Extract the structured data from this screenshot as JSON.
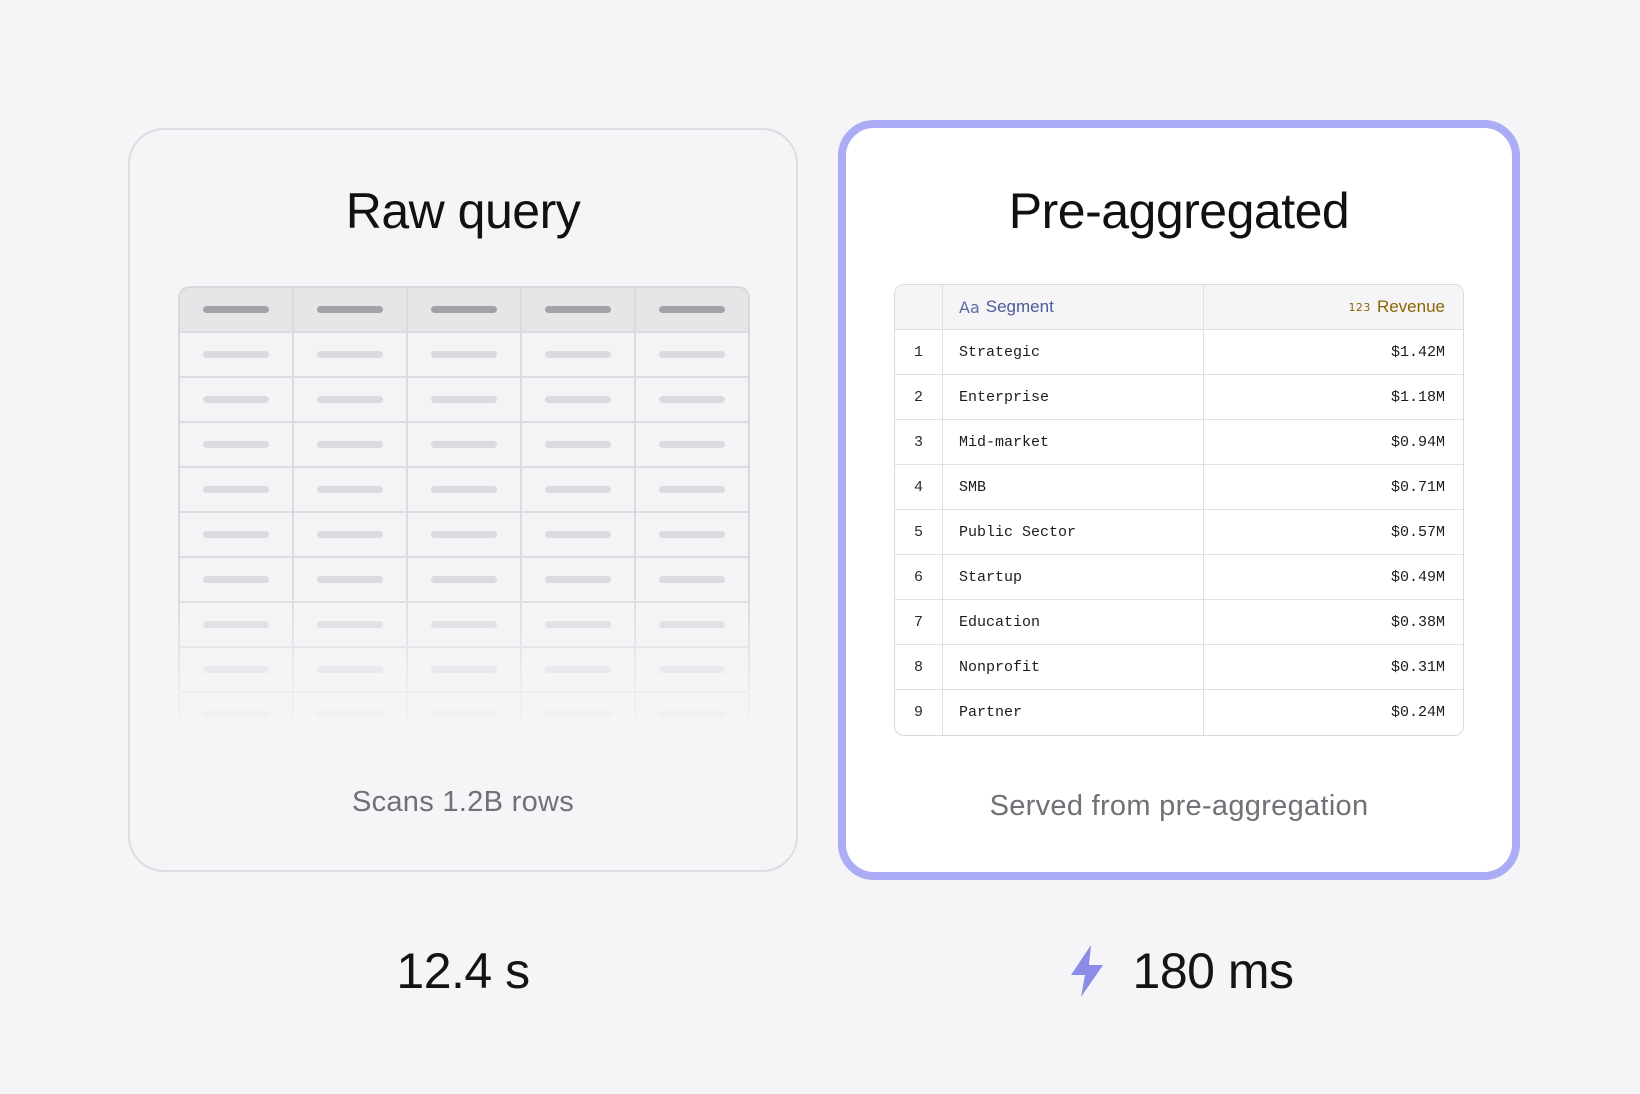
{
  "raw": {
    "title": "Raw query",
    "caption": "Scans 1.2B rows",
    "timing": "12.4 s"
  },
  "pre": {
    "title": "Pre-aggregated",
    "caption": "Served from pre-aggregation",
    "timing": "180 ms",
    "timing_icon": "lightning-bolt-icon",
    "table": {
      "columns": [
        {
          "label": "Segment",
          "type_icon": "Aa"
        },
        {
          "label": "Revenue",
          "type_icon": "123"
        }
      ],
      "rows": [
        {
          "index": "1",
          "segment": "Strategic",
          "revenue": "$1.42M"
        },
        {
          "index": "2",
          "segment": "Enterprise",
          "revenue": "$1.18M"
        },
        {
          "index": "3",
          "segment": "Mid-market",
          "revenue": "$0.94M"
        },
        {
          "index": "4",
          "segment": "SMB",
          "revenue": "$0.71M"
        },
        {
          "index": "5",
          "segment": "Public Sector",
          "revenue": "$0.57M"
        },
        {
          "index": "6",
          "segment": "Startup",
          "revenue": "$0.49M"
        },
        {
          "index": "7",
          "segment": "Education",
          "revenue": "$0.38M"
        },
        {
          "index": "8",
          "segment": "Nonprofit",
          "revenue": "$0.31M"
        },
        {
          "index": "9",
          "segment": "Partner",
          "revenue": "$0.24M"
        }
      ]
    }
  },
  "colors": {
    "accent_border": "#acacf6",
    "bolt": "#8b8be8",
    "segment_header": "#4b5a9a",
    "revenue_header": "#8a6500"
  }
}
